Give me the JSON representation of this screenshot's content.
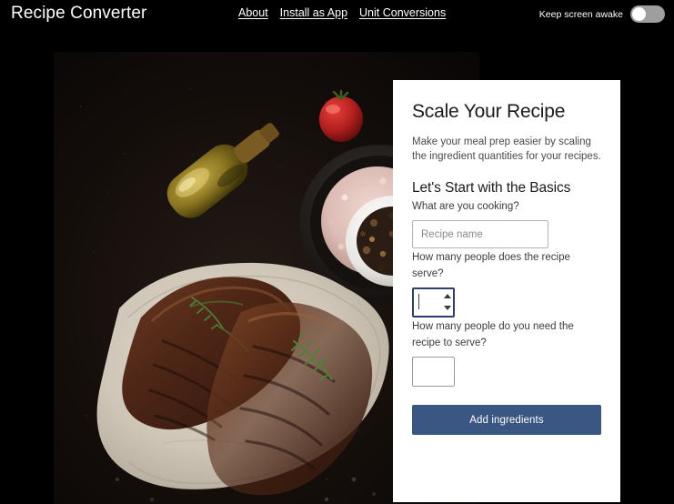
{
  "header": {
    "brand": "Recipe Converter",
    "nav": [
      {
        "label": "About",
        "name": "nav-link-about"
      },
      {
        "label": "Install as App",
        "name": "nav-link-install-as-app"
      },
      {
        "label": "Unit Conversions",
        "name": "nav-link-unit-conversions"
      }
    ],
    "keep_awake_label": "Keep screen awake",
    "keep_awake_state": "off"
  },
  "hero": {
    "alt": "Grilled steaks on parchment with rosemary, peppercorns, salt and olive oil on dark slate",
    "icon": "steak-photo"
  },
  "card": {
    "title": "Scale Your Recipe",
    "description": "Make your meal prep easier by scaling the ingredient quantities for your recipes.",
    "section_title": "Let's Start with the Basics",
    "fields": {
      "recipe_name": {
        "label": "What are you cooking?",
        "placeholder": "Recipe name",
        "value": ""
      },
      "serves_current": {
        "label": "How many people does the recipe serve?",
        "value": "",
        "placeholder": "",
        "focused": true
      },
      "serves_target": {
        "label": "How many people do you need the recipe to serve?",
        "value": "",
        "placeholder": "",
        "focused": false
      }
    },
    "submit_label": "Add ingredients"
  },
  "colors": {
    "page_background": "#000000",
    "card_background": "#ffffff",
    "button_accent": "#3a5682",
    "focus_border": "#2c3e72",
    "toggle_track": "#9e9e9e"
  }
}
